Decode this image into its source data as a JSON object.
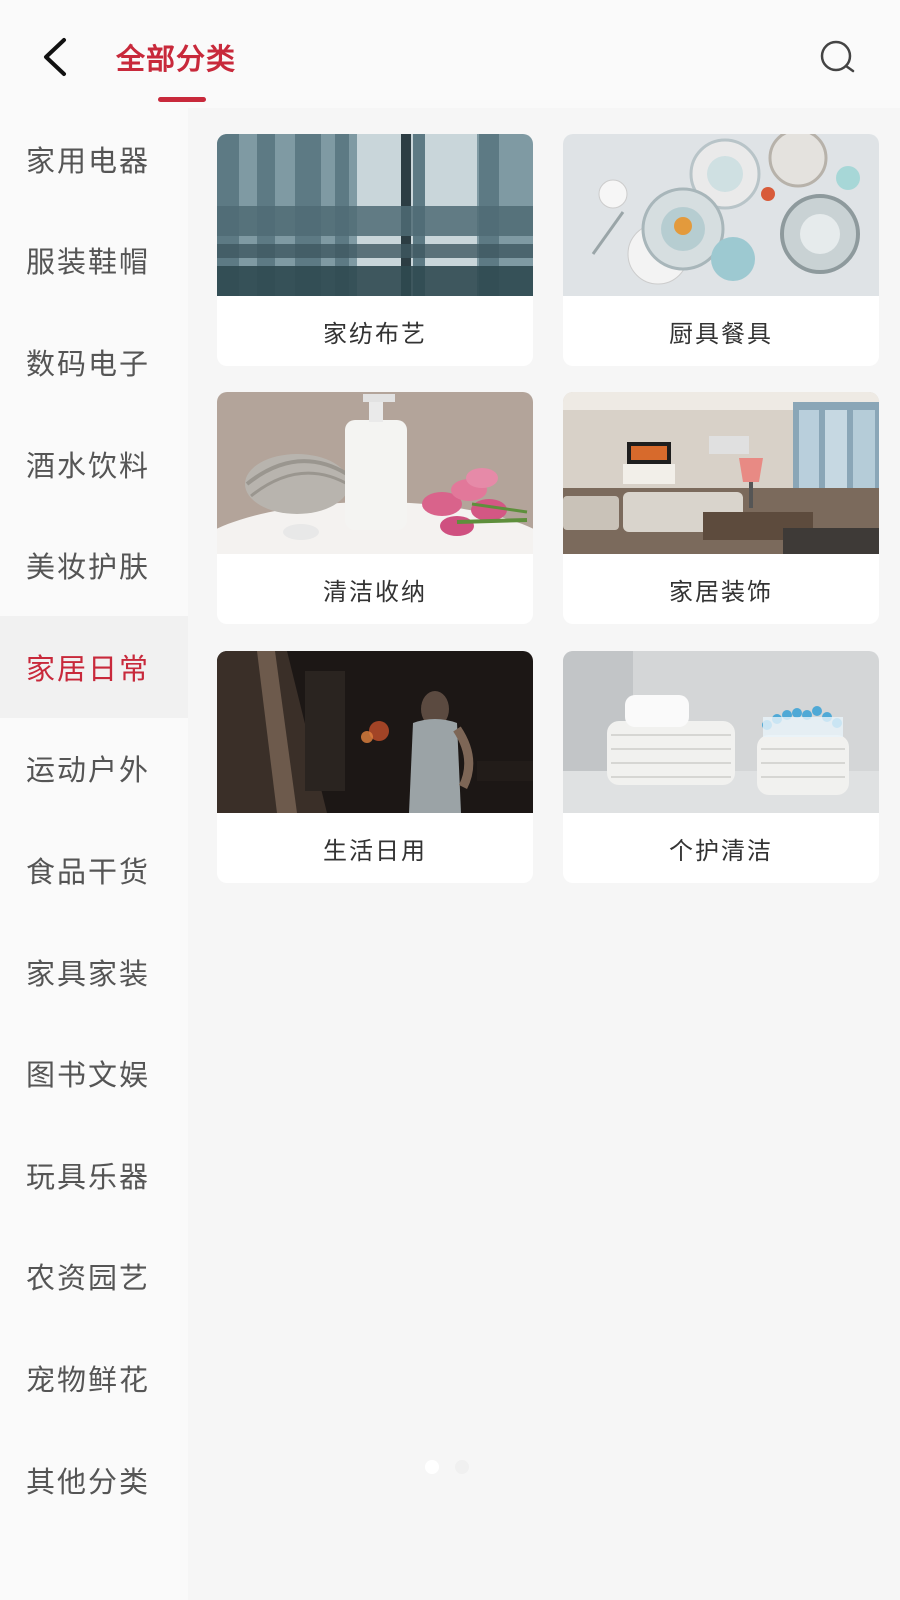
{
  "header": {
    "title": "全部分类",
    "accent_color": "#c8293b",
    "back_icon": "chevron-left-icon",
    "search_icon": "search-icon"
  },
  "sidebar": {
    "active_index": 5,
    "items": [
      {
        "label": "家用电器"
      },
      {
        "label": "服装鞋帽"
      },
      {
        "label": "数码电子"
      },
      {
        "label": "酒水饮料"
      },
      {
        "label": "美妆护肤"
      },
      {
        "label": "家居日常"
      },
      {
        "label": "运动户外"
      },
      {
        "label": "食品干货"
      },
      {
        "label": "家具家装"
      },
      {
        "label": "图书文娱"
      },
      {
        "label": "玩具乐器"
      },
      {
        "label": "农资园艺"
      },
      {
        "label": "宠物鲜花"
      },
      {
        "label": "其他分类"
      }
    ]
  },
  "categories": [
    {
      "label": "家纺布艺",
      "image": "curtain-photo"
    },
    {
      "label": "厨具餐具",
      "image": "tableware-photo"
    },
    {
      "label": "清洁收纳",
      "image": "towel-soap-flowers-photo"
    },
    {
      "label": "家居装饰",
      "image": "living-room-photo"
    },
    {
      "label": "生活日用",
      "image": "kitchen-person-photo"
    },
    {
      "label": "个护清洁",
      "image": "cotton-basket-photo"
    }
  ],
  "pager": {
    "count": 2,
    "active": 0
  }
}
